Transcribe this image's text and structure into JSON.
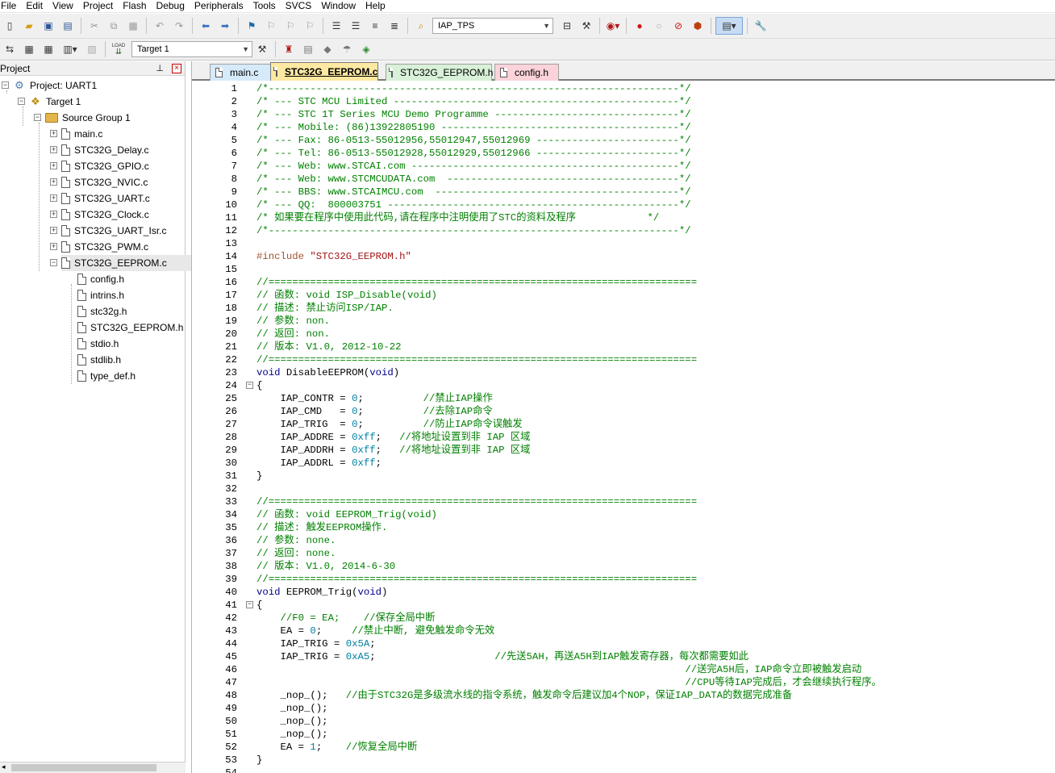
{
  "menu": [
    "File",
    "Edit",
    "View",
    "Project",
    "Flash",
    "Debug",
    "Peripherals",
    "Tools",
    "SVCS",
    "Window",
    "Help"
  ],
  "toolbar1": {
    "find_combo": "IAP_TPS",
    "icons": [
      "new-file-icon",
      "open-folder-icon",
      "save-icon",
      "save-all-icon",
      "cut-icon",
      "copy-icon",
      "paste-icon",
      "undo-icon",
      "redo-icon",
      "nav-back-icon",
      "nav-forward-icon",
      "bookmark-icon",
      "bookmark-prev-icon",
      "bookmark-next-icon",
      "bookmark-clear-icon",
      "indent-icon",
      "unindent-icon",
      "comment-icon",
      "uncomment-icon",
      "find-in-files-icon",
      "find-icon",
      "debug-start-icon",
      "breakpoint-icon",
      "breakpoint-disable-icon",
      "breakpoint-kill-icon",
      "breakpoint-clear-icon",
      "window-layout-icon",
      "configure-icon"
    ]
  },
  "toolbar2": {
    "target_combo": "Target 1",
    "load_label": "LOAD",
    "icons": [
      "translate-icon",
      "build-icon",
      "rebuild-icon",
      "batch-build-icon",
      "stop-build-icon",
      "download-icon",
      "target-options-icon",
      "manage-components-icon",
      "select-pack-icon",
      "file-extensions-icon",
      "run-time-env-icon",
      "pack-installer-icon"
    ]
  },
  "project_panel": {
    "title": "Project",
    "tree": [
      {
        "label": "Project: UART1",
        "icon": "project-icon",
        "depth": 0,
        "expander": "-"
      },
      {
        "label": "Target 1",
        "icon": "target-icon",
        "depth": 1,
        "expander": "-"
      },
      {
        "label": "Source Group 1",
        "icon": "folder-icon",
        "depth": 2,
        "expander": "-"
      },
      {
        "label": "main.c",
        "icon": "file-icon",
        "depth": 3,
        "expander": "+"
      },
      {
        "label": "STC32G_Delay.c",
        "icon": "file-icon",
        "depth": 3,
        "expander": "+"
      },
      {
        "label": "STC32G_GPIO.c",
        "icon": "file-icon",
        "depth": 3,
        "expander": "+"
      },
      {
        "label": "STC32G_NVIC.c",
        "icon": "file-icon",
        "depth": 3,
        "expander": "+"
      },
      {
        "label": "STC32G_UART.c",
        "icon": "file-icon",
        "depth": 3,
        "expander": "+"
      },
      {
        "label": "STC32G_Clock.c",
        "icon": "file-icon",
        "depth": 3,
        "expander": "+"
      },
      {
        "label": "STC32G_UART_Isr.c",
        "icon": "file-icon",
        "depth": 3,
        "expander": "+"
      },
      {
        "label": "STC32G_PWM.c",
        "icon": "file-icon",
        "depth": 3,
        "expander": "+"
      },
      {
        "label": "STC32G_EEPROM.c",
        "icon": "file-icon",
        "depth": 3,
        "expander": "-",
        "selected": true
      },
      {
        "label": "config.h",
        "icon": "file-icon",
        "depth": 4,
        "expander": ""
      },
      {
        "label": "intrins.h",
        "icon": "file-icon",
        "depth": 4,
        "expander": ""
      },
      {
        "label": "stc32g.h",
        "icon": "file-icon",
        "depth": 4,
        "expander": ""
      },
      {
        "label": "STC32G_EEPROM.h",
        "icon": "file-icon",
        "depth": 4,
        "expander": ""
      },
      {
        "label": "stdio.h",
        "icon": "file-icon",
        "depth": 4,
        "expander": ""
      },
      {
        "label": "stdlib.h",
        "icon": "file-icon",
        "depth": 4,
        "expander": ""
      },
      {
        "label": "type_def.h",
        "icon": "file-icon",
        "depth": 4,
        "expander": ""
      }
    ]
  },
  "tabs": [
    {
      "label": "main.c",
      "bg": "#d6ebfa",
      "active": false
    },
    {
      "label": "STC32G_EEPROM.c",
      "bg": "#fde9a2",
      "active": true
    },
    {
      "label": "STC32G_EEPROM.h",
      "bg": "#d9f1d9",
      "active": false
    },
    {
      "label": "config.h",
      "bg": "#fbd3d9",
      "active": false
    }
  ],
  "code_lines": [
    [
      [
        "cmt",
        "/*---------------------------------------------------------------------*/"
      ]
    ],
    [
      [
        "cmt",
        "/* --- STC MCU Limited ------------------------------------------------*/"
      ]
    ],
    [
      [
        "cmt",
        "/* --- STC 1T Series MCU Demo Programme -------------------------------*/"
      ]
    ],
    [
      [
        "cmt",
        "/* --- Mobile: (86)13922805190 ----------------------------------------*/"
      ]
    ],
    [
      [
        "cmt",
        "/* --- Fax: 86-0513-55012956,55012947,55012969 ------------------------*/"
      ]
    ],
    [
      [
        "cmt",
        "/* --- Tel: 86-0513-55012928,55012929,55012966 ------------------------*/"
      ]
    ],
    [
      [
        "cmt",
        "/* --- Web: www.STCAI.com ---------------------------------------------*/"
      ]
    ],
    [
      [
        "cmt",
        "/* --- Web: www.STCMCUDATA.com  ---------------------------------------*/"
      ]
    ],
    [
      [
        "cmt",
        "/* --- BBS: www.STCAIMCU.com  -----------------------------------------*/"
      ]
    ],
    [
      [
        "cmt",
        "/* --- QQ:  800003751 -------------------------------------------------*/"
      ]
    ],
    [
      [
        "cmt",
        "/* 如果要在程序中使用此代码,请在程序中注明使用了STC的资料及程序            */"
      ]
    ],
    [
      [
        "cmt",
        "/*---------------------------------------------------------------------*/"
      ]
    ],
    [],
    [
      [
        "pp",
        "#include "
      ],
      [
        "str",
        "\"STC32G_EEPROM.h\""
      ]
    ],
    [],
    [
      [
        "cmt",
        "//========================================================================"
      ]
    ],
    [
      [
        "cmt",
        "// 函数: void ISP_Disable(void)"
      ]
    ],
    [
      [
        "cmt",
        "// 描述: 禁止访问ISP/IAP."
      ]
    ],
    [
      [
        "cmt",
        "// 参数: non."
      ]
    ],
    [
      [
        "cmt",
        "// 返回: non."
      ]
    ],
    [
      [
        "cmt",
        "// 版本: V1.0, 2012-10-22"
      ]
    ],
    [
      [
        "cmt",
        "//========================================================================"
      ]
    ],
    [
      [
        "kw",
        "void"
      ],
      [
        "txt",
        " DisableEEPROM("
      ],
      [
        "kw",
        "void"
      ],
      [
        "txt",
        ")"
      ]
    ],
    [
      [
        "txt",
        "{"
      ]
    ],
    [
      [
        "txt",
        "    IAP_CONTR = "
      ],
      [
        "num",
        "0"
      ],
      [
        "txt",
        ";          "
      ],
      [
        "cmt",
        "//禁止IAP操作"
      ]
    ],
    [
      [
        "txt",
        "    IAP_CMD   = "
      ],
      [
        "num",
        "0"
      ],
      [
        "txt",
        ";          "
      ],
      [
        "cmt",
        "//去除IAP命令"
      ]
    ],
    [
      [
        "txt",
        "    IAP_TRIG  = "
      ],
      [
        "num",
        "0"
      ],
      [
        "txt",
        ";          "
      ],
      [
        "cmt",
        "//防止IAP命令误触发"
      ]
    ],
    [
      [
        "txt",
        "    IAP_ADDRE = "
      ],
      [
        "num",
        "0xff"
      ],
      [
        "txt",
        ";   "
      ],
      [
        "cmt",
        "//将地址设置到非 IAP 区域"
      ]
    ],
    [
      [
        "txt",
        "    IAP_ADDRH = "
      ],
      [
        "num",
        "0xff"
      ],
      [
        "txt",
        ";   "
      ],
      [
        "cmt",
        "//将地址设置到非 IAP 区域"
      ]
    ],
    [
      [
        "txt",
        "    IAP_ADDRL = "
      ],
      [
        "num",
        "0xff"
      ],
      [
        "txt",
        ";"
      ]
    ],
    [
      [
        "txt",
        "}"
      ]
    ],
    [],
    [
      [
        "cmt",
        "//========================================================================"
      ]
    ],
    [
      [
        "cmt",
        "// 函数: void EEPROM_Trig(void)"
      ]
    ],
    [
      [
        "cmt",
        "// 描述: 触发EEPROM操作."
      ]
    ],
    [
      [
        "cmt",
        "// 参数: none."
      ]
    ],
    [
      [
        "cmt",
        "// 返回: none."
      ]
    ],
    [
      [
        "cmt",
        "// 版本: V1.0, 2014-6-30"
      ]
    ],
    [
      [
        "cmt",
        "//========================================================================"
      ]
    ],
    [
      [
        "kw",
        "void"
      ],
      [
        "txt",
        " EEPROM_Trig("
      ],
      [
        "kw",
        "void"
      ],
      [
        "txt",
        ")"
      ]
    ],
    [
      [
        "txt",
        "{"
      ]
    ],
    [
      [
        "txt",
        "    "
      ],
      [
        "cmt",
        "//F0 = EA;    //保存全局中断"
      ]
    ],
    [
      [
        "txt",
        "    EA = "
      ],
      [
        "num",
        "0"
      ],
      [
        "txt",
        ";     "
      ],
      [
        "cmt",
        "//禁止中断, 避免触发命令无效"
      ]
    ],
    [
      [
        "txt",
        "    IAP_TRIG = "
      ],
      [
        "num",
        "0x5A"
      ],
      [
        "txt",
        ";"
      ]
    ],
    [
      [
        "txt",
        "    IAP_TRIG = "
      ],
      [
        "num",
        "0xA5"
      ],
      [
        "txt",
        ";                    "
      ],
      [
        "cmt",
        "//先送5AH，再送A5H到IAP触发寄存器，每次都需要如此"
      ]
    ],
    [
      [
        "txt",
        "                                                                        "
      ],
      [
        "cmt",
        "//送完A5H后，IAP命令立即被触发启动"
      ]
    ],
    [
      [
        "txt",
        "                                                                        "
      ],
      [
        "cmt",
        "//CPU等待IAP完成后，才会继续执行程序。"
      ]
    ],
    [
      [
        "txt",
        "    _nop_();   "
      ],
      [
        "cmt",
        "//由于STC32G是多级流水线的指令系统，触发命令后建议加4个NOP，保证IAP_DATA的数据完成准备"
      ]
    ],
    [
      [
        "txt",
        "    _nop_();"
      ]
    ],
    [
      [
        "txt",
        "    _nop_();"
      ]
    ],
    [
      [
        "txt",
        "    _nop_();"
      ]
    ],
    [
      [
        "txt",
        "    EA = "
      ],
      [
        "num",
        "1"
      ],
      [
        "txt",
        ";    "
      ],
      [
        "cmt",
        "//恢复全局中断"
      ]
    ],
    [
      [
        "txt",
        "}"
      ]
    ],
    []
  ],
  "line_numbers": [
    "1",
    "2",
    "3",
    "4",
    "5",
    "6",
    "7",
    "8",
    "9",
    "10",
    "11",
    "12",
    "13",
    "14",
    "15",
    "16",
    "17",
    "18",
    "19",
    "20",
    "21",
    "22",
    "23",
    "24",
    "25",
    "26",
    "27",
    "28",
    "29",
    "30",
    "31",
    "32",
    "33",
    "34",
    "35",
    "36",
    "37",
    "38",
    "39",
    "40",
    "41",
    "42",
    "43",
    "44",
    "45",
    "46",
    "47",
    "48",
    "49",
    "50",
    "51",
    "52",
    "53",
    "54"
  ],
  "fold_markers": {
    "24": "-",
    "41": "-"
  }
}
